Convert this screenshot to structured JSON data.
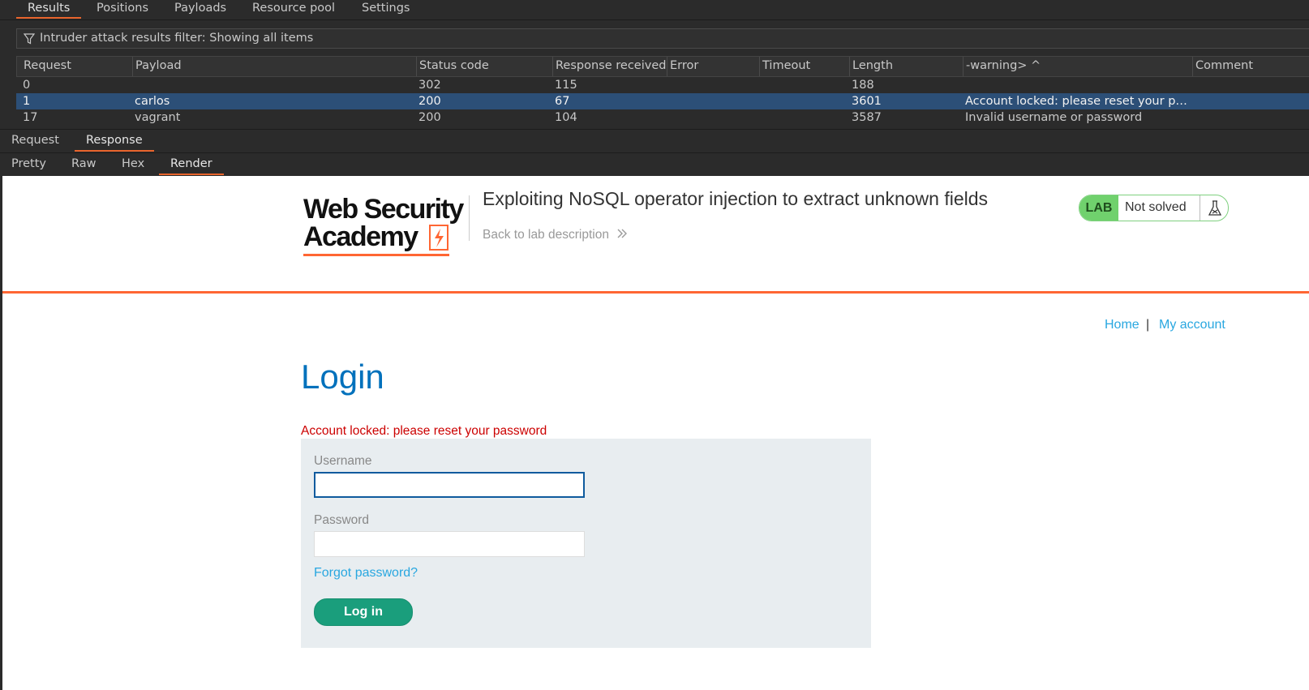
{
  "burp": {
    "main_tabs": [
      "Results",
      "Positions",
      "Payloads",
      "Resource pool",
      "Settings"
    ],
    "active_main_tab": "Results",
    "filter_text": "Intruder attack results filter: Showing all items",
    "columns": [
      "Request",
      "Payload",
      "Status code",
      "Response received",
      "Error",
      "Timeout",
      "Length",
      "-warning> ^",
      "Comment"
    ],
    "rows": [
      {
        "request": "0",
        "payload": "",
        "status": "302",
        "received": "115",
        "error": "",
        "timeout": "",
        "length": "188",
        "warning": "",
        "comment": ""
      },
      {
        "request": "1",
        "payload": "carlos",
        "status": "200",
        "received": "67",
        "error": "",
        "timeout": "",
        "length": "3601",
        "warning": "Account locked: please reset your p…",
        "comment": ""
      },
      {
        "request": "17",
        "payload": "vagrant",
        "status": "200",
        "received": "104",
        "error": "",
        "timeout": "",
        "length": "3587",
        "warning": "Invalid username or password",
        "comment": ""
      }
    ],
    "selected_row": 1,
    "req_resp_tabs": [
      "Request",
      "Response"
    ],
    "active_req_resp_tab": "Response",
    "view_tabs": [
      "Pretty",
      "Raw",
      "Hex",
      "Render"
    ],
    "active_view_tab": "Render"
  },
  "page": {
    "logo_line1": "Web Security",
    "logo_line2": "Academy",
    "lab_title": "Exploiting NoSQL operator injection to extract unknown fields",
    "back_link": "Back to lab description",
    "badge_lab": "LAB",
    "badge_status": "Not solved",
    "nav_home": "Home",
    "nav_sep": "|",
    "nav_account": "My account",
    "heading": "Login",
    "error_message": "Account locked: please reset your password",
    "username_label": "Username",
    "username_value": "",
    "password_label": "Password",
    "password_value": "",
    "forgot_link": "Forgot password?",
    "login_button": "Log in"
  },
  "colors": {
    "accent": "#e8642c",
    "selected_row": "#2c4f77",
    "brand_orange": "#ff6633",
    "link_blue": "#29a7e0",
    "heading_blue": "#0071bc",
    "error_red": "#cc0000",
    "button_green": "#1a9e7c",
    "lab_green": "#70d16d"
  },
  "icons": [
    "filter-icon",
    "sort-up-icon",
    "double-chevron-right-icon",
    "flask-icon",
    "lightning-bolt-icon"
  ]
}
